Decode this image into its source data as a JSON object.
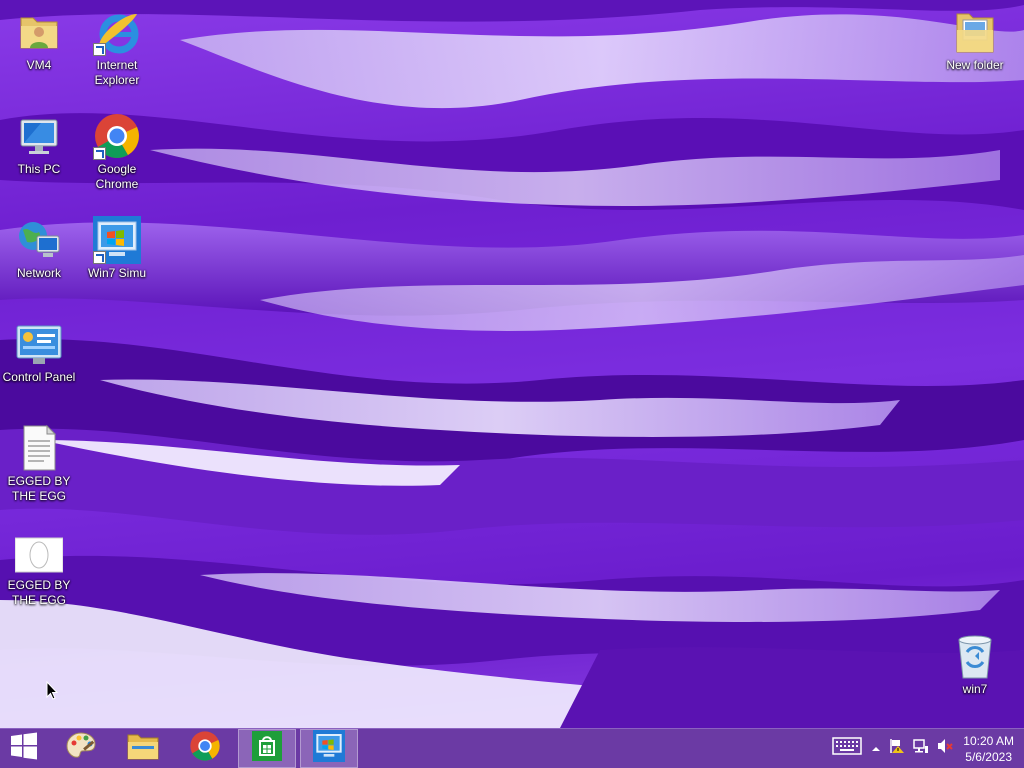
{
  "desktop": {
    "icons": [
      {
        "id": "vm4",
        "label": "VM4",
        "icon": "user-folder-icon"
      },
      {
        "id": "ie",
        "label": "Internet Explorer",
        "icon": "internet-explorer-icon"
      },
      {
        "id": "thispc",
        "label": "This PC",
        "icon": "computer-icon"
      },
      {
        "id": "chrome",
        "label": "Google Chrome",
        "icon": "chrome-icon"
      },
      {
        "id": "network",
        "label": "Network",
        "icon": "network-icon"
      },
      {
        "id": "win7simu",
        "label": "Win7 Simu",
        "icon": "win7-simulator-icon"
      },
      {
        "id": "controlpanel",
        "label": "Control Panel",
        "icon": "control-panel-icon"
      },
      {
        "id": "egg1",
        "label": "EGGED BY THE EGG",
        "icon": "text-document-icon"
      },
      {
        "id": "egg2",
        "label": "EGGED BY THE EGG",
        "icon": "image-file-icon"
      },
      {
        "id": "newfolder",
        "label": "New folder",
        "icon": "folder-icon"
      },
      {
        "id": "win7bin",
        "label": "win7",
        "icon": "recycle-bin-icon"
      }
    ]
  },
  "taskbar": {
    "buttons": [
      {
        "label": "Start",
        "icon": "windows-logo-icon"
      },
      {
        "label": "Paint",
        "icon": "paint-palette-icon"
      },
      {
        "label": "File Explorer",
        "icon": "file-explorer-icon"
      },
      {
        "label": "Google Chrome",
        "icon": "chrome-icon"
      },
      {
        "label": "Store",
        "icon": "store-icon"
      },
      {
        "label": "Win7 Simu",
        "icon": "win7-simulator-icon"
      }
    ],
    "tray": {
      "icons": [
        "touch-keyboard-icon",
        "show-hidden-icons-chevron",
        "action-center-flag-icon",
        "network-status-icon",
        "volume-muted-icon"
      ],
      "time": "10:20 AM",
      "date": "5/6/2023"
    }
  },
  "colors": {
    "wallpaper_primary": "#7a2fd6",
    "taskbar": "#6b3aa4"
  }
}
